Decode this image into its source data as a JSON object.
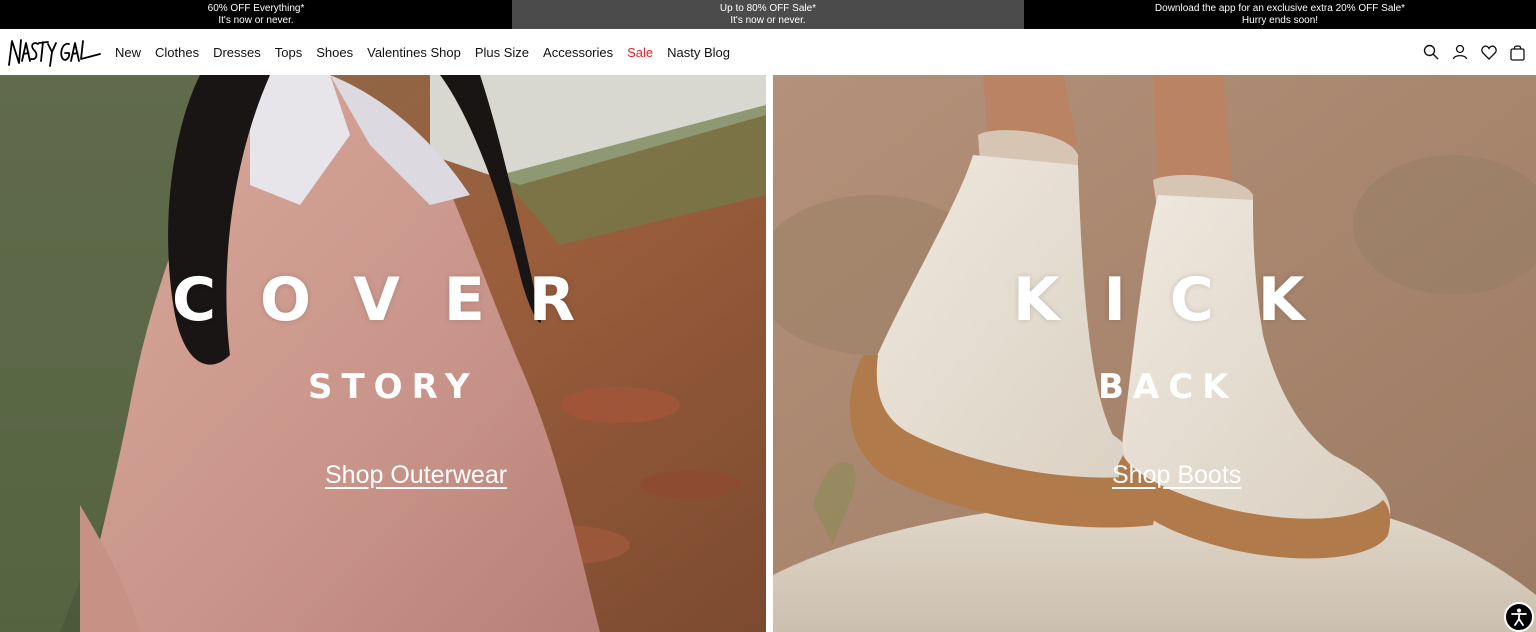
{
  "promo": [
    {
      "line1": "60% OFF Everything*",
      "line2": "It's now or never."
    },
    {
      "line1": "Up to 80% OFF Sale*",
      "line2": "It's now or never."
    },
    {
      "line1": "Download the app for an exclusive extra 20% OFF Sale*",
      "line2": "Hurry ends soon!"
    }
  ],
  "brand": {
    "logo_text": "NASTY GAL"
  },
  "nav": [
    {
      "label": "New"
    },
    {
      "label": "Clothes"
    },
    {
      "label": "Dresses"
    },
    {
      "label": "Tops"
    },
    {
      "label": "Shoes"
    },
    {
      "label": "Valentines Shop"
    },
    {
      "label": "Plus Size"
    },
    {
      "label": "Accessories"
    },
    {
      "label": "Sale"
    },
    {
      "label": "Nasty Blog"
    }
  ],
  "header_icons": [
    "search-icon",
    "account-icon",
    "wishlist-heart-icon",
    "bag-icon"
  ],
  "colors": {
    "sale": "#e0232e",
    "promo_dark": "#000000",
    "promo_mid": "#4b4b4b"
  },
  "hero": {
    "left": {
      "headline": "COVER",
      "subhead": "STORY",
      "cta": "Shop Outerwear"
    },
    "right": {
      "headline": "KICK",
      "subhead": "BACK",
      "cta": "Shop Boots"
    }
  }
}
